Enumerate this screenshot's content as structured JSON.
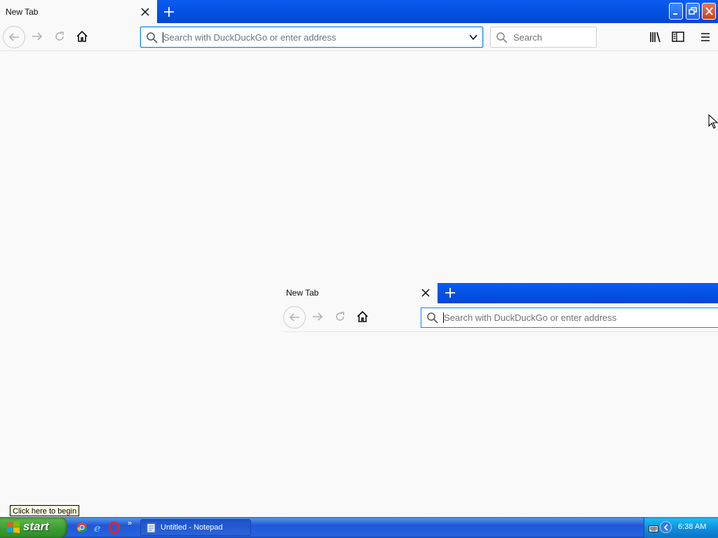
{
  "browser": {
    "tab": {
      "title": "New Tab"
    },
    "urlbar": {
      "placeholder": "Search with DuckDuckGo or enter address"
    },
    "searchbar": {
      "placeholder": "Search"
    }
  },
  "ghost_browser": {
    "tab": {
      "title": "New Tab"
    },
    "urlbar": {
      "placeholder": "Search with DuckDuckGo or enter address"
    }
  },
  "tooltip": {
    "text": "Click here to begin"
  },
  "taskbar": {
    "start_label": "start",
    "tasks": [
      {
        "label": "Untitled - Notepad"
      }
    ],
    "clock": "6:38 AM",
    "quick_launch": [
      "chrome-icon",
      "ie-icon",
      "opera-icon"
    ]
  },
  "colors": {
    "tabstrip": "#0047d6",
    "accent": "#0a84ff",
    "page_bg": "#f9f9fa",
    "start_green": "#3a9a32",
    "taskbar_blue": "#2157d7"
  }
}
